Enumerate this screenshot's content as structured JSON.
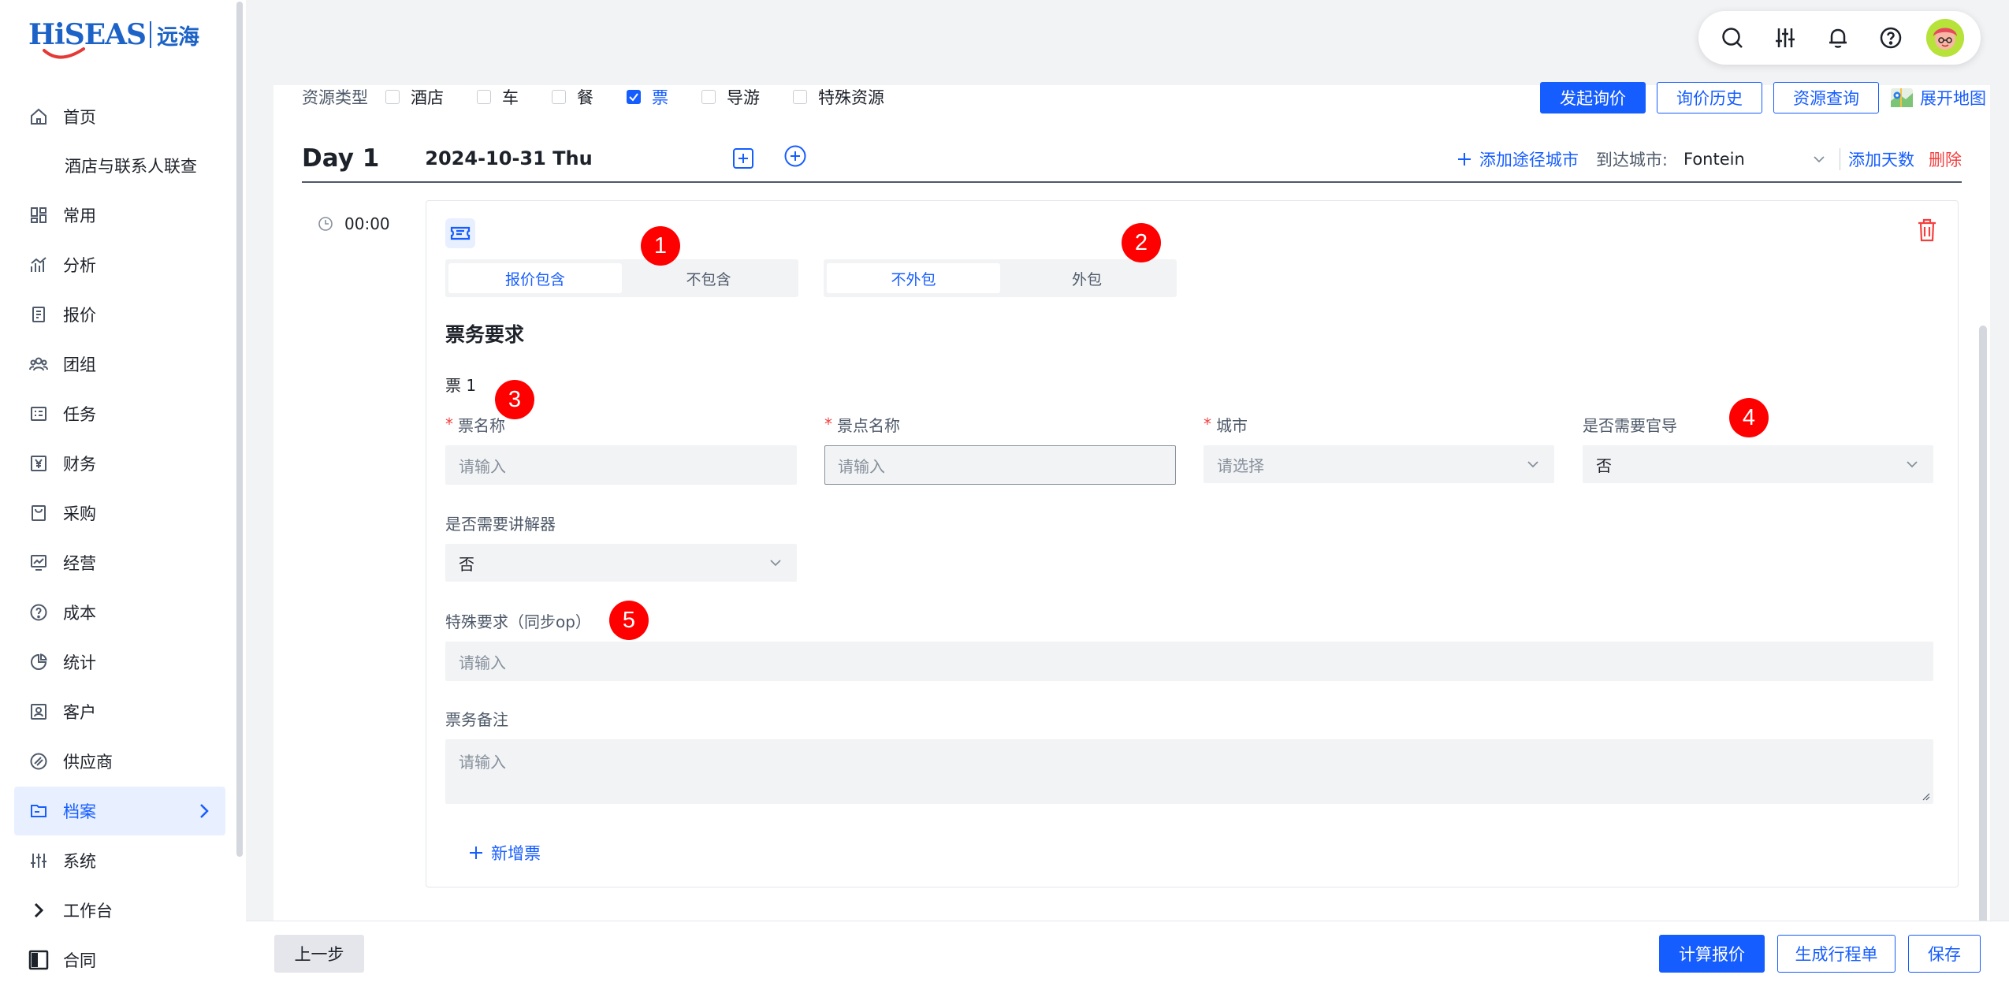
{
  "brand": {
    "logo_text": "HiSEAS",
    "logo_cn": "远海"
  },
  "sidebar": {
    "items": [
      {
        "label": "首页",
        "icon": "home-icon"
      },
      {
        "label": "酒店与联系人联查",
        "icon": ""
      },
      {
        "label": "常用",
        "icon": "grid-icon"
      },
      {
        "label": "分析",
        "icon": "analytics-icon"
      },
      {
        "label": "报价",
        "icon": "document-icon"
      },
      {
        "label": "团组",
        "icon": "group-icon"
      },
      {
        "label": "任务",
        "icon": "task-icon"
      },
      {
        "label": "财务",
        "icon": "yen-icon"
      },
      {
        "label": "采购",
        "icon": "bag-icon"
      },
      {
        "label": "经营",
        "icon": "chart-icon"
      },
      {
        "label": "成本",
        "icon": "question-circle-icon"
      },
      {
        "label": "统计",
        "icon": "pie-icon"
      },
      {
        "label": "客户",
        "icon": "contact-icon"
      },
      {
        "label": "供应商",
        "icon": "supplier-icon"
      },
      {
        "label": "档案",
        "icon": "folder-icon",
        "active": true
      },
      {
        "label": "系统",
        "icon": "sliders-icon"
      },
      {
        "label": "工作台",
        "icon": "chevron-right-icon"
      },
      {
        "label": "合同",
        "icon": "contract-icon"
      }
    ]
  },
  "resource": {
    "label": "资源类型",
    "options": [
      {
        "label": "酒店",
        "checked": false
      },
      {
        "label": "车",
        "checked": false
      },
      {
        "label": "餐",
        "checked": false
      },
      {
        "label": "票",
        "checked": true
      },
      {
        "label": "导游",
        "checked": false
      },
      {
        "label": "特殊资源",
        "checked": false
      }
    ]
  },
  "top_actions": {
    "start_inquiry": "发起询价",
    "inquiry_history": "询价历史",
    "resource_query": "资源查询",
    "expand_map": "展开地图"
  },
  "day": {
    "title": "Day 1",
    "date": "2024-10-31 Thu",
    "add_route_city": "添加途径城市",
    "arrive_city_label": "到达城市:",
    "arrive_city_value": "Fontein",
    "add_days": "添加天数",
    "delete": "删除"
  },
  "time": "00:00",
  "ticket": {
    "seg1": [
      "报价包含",
      "不包含"
    ],
    "seg2": [
      "不外包",
      "外包"
    ],
    "section_title": "票务要求",
    "ticket_num": "票 1",
    "fields": {
      "ticket_name": {
        "label": "票名称",
        "placeholder": "请输入"
      },
      "spot_name": {
        "label": "景点名称",
        "placeholder": "请输入"
      },
      "city": {
        "label": "城市",
        "placeholder": "请选择"
      },
      "need_guide": {
        "label": "是否需要官导",
        "value": "否"
      },
      "need_audio": {
        "label": "是否需要讲解器",
        "value": "否"
      },
      "special_req": {
        "label": "特殊要求（同步op）",
        "placeholder": "请输入"
      },
      "remark": {
        "label": "票务备注",
        "placeholder": "请输入"
      }
    },
    "add_ticket": "新增票"
  },
  "markers": [
    "1",
    "2",
    "3",
    "4",
    "5"
  ],
  "footer": {
    "prev": "上一步",
    "calc": "计算报价",
    "gen_itinerary": "生成行程单",
    "save": "保存"
  },
  "colors": {
    "primary": "#165dff",
    "danger": "#f53f3f",
    "marker": "#ff0000"
  }
}
